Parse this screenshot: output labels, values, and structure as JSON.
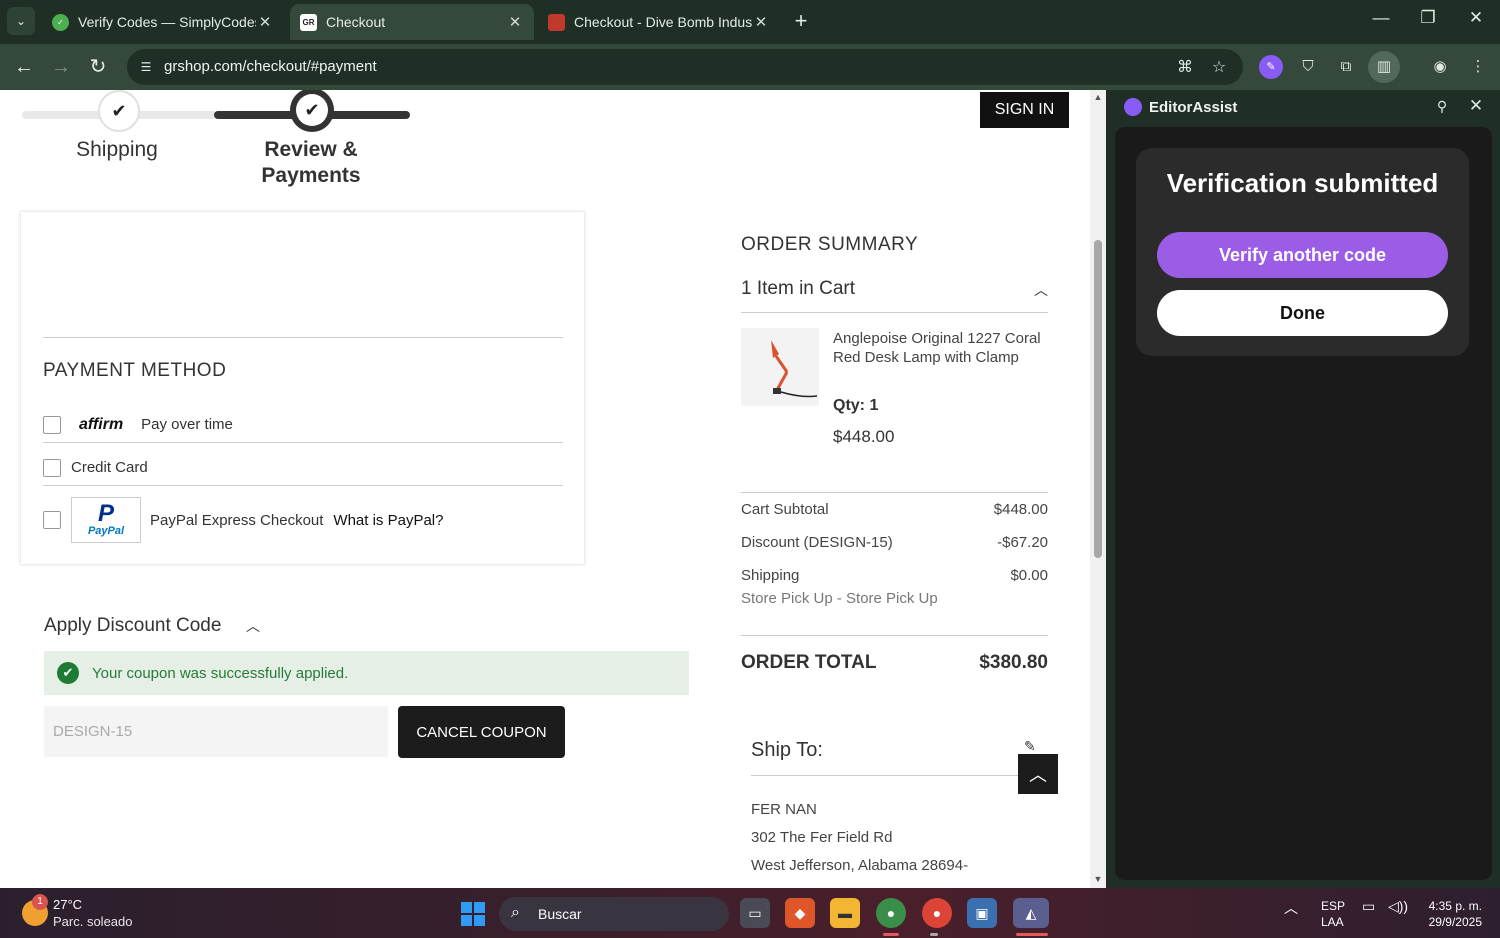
{
  "browser": {
    "tabs": [
      {
        "title": "Verify Codes — SimplyCodes",
        "icon": "simplycodes-favicon",
        "color": "#4caf50"
      },
      {
        "title": "Checkout",
        "icon": "grshop-favicon",
        "color": "#ffffff"
      },
      {
        "title": "Checkout - Dive Bomb Industrie",
        "icon": "divebomb-favicon",
        "color": "#c0392b"
      }
    ],
    "close_glyph": "✕",
    "new_tab_glyph": "+",
    "url": "grshop.com/checkout/#payment",
    "theme_color": "#34493b"
  },
  "checkout": {
    "steps": [
      {
        "label": "Shipping",
        "state": "done"
      },
      {
        "label": "Review & Payments",
        "state": "active"
      }
    ],
    "sign_in_label": "SIGN IN",
    "payment_method_title": "PAYMENT METHOD",
    "payment_options": [
      {
        "logo": "affirm",
        "label": "Pay over time"
      },
      {
        "label": "Credit Card"
      },
      {
        "logo_main": "P",
        "logo_text": "PayPal",
        "label": "PayPal Express Checkout",
        "link": "What is PayPal?"
      }
    ],
    "discount": {
      "title": "Apply Discount Code",
      "success_message": "Your coupon was successfully applied.",
      "code_value": "DESIGN-15",
      "cancel_label": "CANCEL COUPON",
      "success_color": "#1e7b34"
    }
  },
  "summary": {
    "title": "ORDER SUMMARY",
    "cart_count": "1 Item in Cart",
    "product": {
      "name": "Anglepoise Original 1227 Coral Red Desk Lamp with Clamp",
      "qty": "Qty: 1",
      "price": "$448.00"
    },
    "rows": [
      {
        "label": "Cart Subtotal",
        "value": "$448.00"
      },
      {
        "label": "Discount (DESIGN-15)",
        "value": "-$67.20"
      },
      {
        "label": "Shipping",
        "value": "$0.00"
      }
    ],
    "shipping_method": "Store Pick Up - Store Pick Up",
    "total_label": "ORDER TOTAL",
    "total_value": "$380.80",
    "ship_to": {
      "title": "Ship To:",
      "lines": [
        "FER NAN",
        "302 The Fer Field Rd",
        "West Jefferson, Alabama 28694-"
      ]
    }
  },
  "side_panel": {
    "title": "EditorAssist",
    "heading": "Verification submitted",
    "verify_another_label": "Verify another code",
    "done_label": "Done",
    "accent": "#9b5de5"
  },
  "taskbar": {
    "weather_temp": "27°C",
    "weather_desc": "Parc. soleado",
    "weather_badge": "1",
    "search_label": "Buscar",
    "lang_top": "ESP",
    "lang_bottom": "LAA",
    "time": "4:35 p. m.",
    "date": "29/9/2025"
  }
}
